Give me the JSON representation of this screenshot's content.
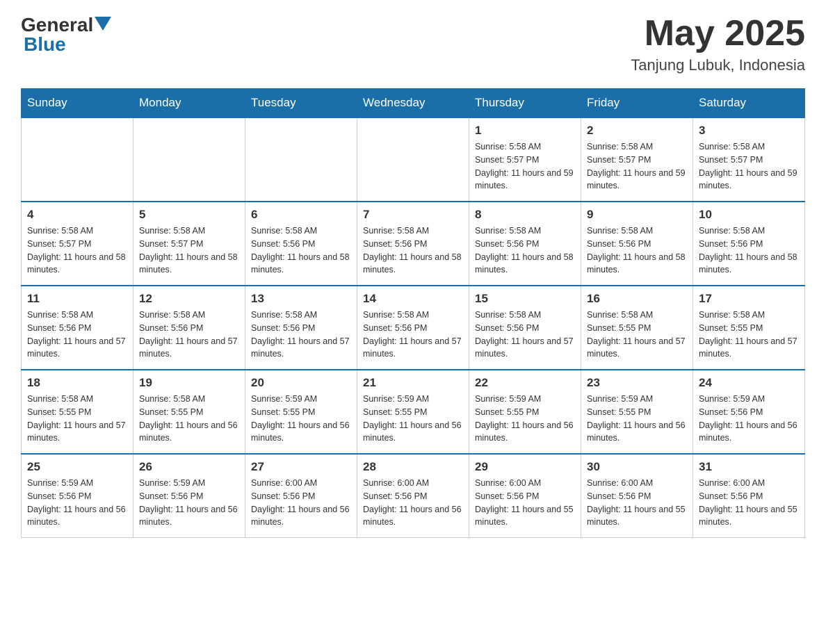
{
  "header": {
    "logo_general": "General",
    "logo_blue": "Blue",
    "month": "May 2025",
    "location": "Tanjung Lubuk, Indonesia"
  },
  "days_of_week": [
    "Sunday",
    "Monday",
    "Tuesday",
    "Wednesday",
    "Thursday",
    "Friday",
    "Saturday"
  ],
  "weeks": [
    [
      {
        "day": "",
        "sunrise": "",
        "sunset": "",
        "daylight": ""
      },
      {
        "day": "",
        "sunrise": "",
        "sunset": "",
        "daylight": ""
      },
      {
        "day": "",
        "sunrise": "",
        "sunset": "",
        "daylight": ""
      },
      {
        "day": "",
        "sunrise": "",
        "sunset": "",
        "daylight": ""
      },
      {
        "day": "1",
        "sunrise": "Sunrise: 5:58 AM",
        "sunset": "Sunset: 5:57 PM",
        "daylight": "Daylight: 11 hours and 59 minutes."
      },
      {
        "day": "2",
        "sunrise": "Sunrise: 5:58 AM",
        "sunset": "Sunset: 5:57 PM",
        "daylight": "Daylight: 11 hours and 59 minutes."
      },
      {
        "day": "3",
        "sunrise": "Sunrise: 5:58 AM",
        "sunset": "Sunset: 5:57 PM",
        "daylight": "Daylight: 11 hours and 59 minutes."
      }
    ],
    [
      {
        "day": "4",
        "sunrise": "Sunrise: 5:58 AM",
        "sunset": "Sunset: 5:57 PM",
        "daylight": "Daylight: 11 hours and 58 minutes."
      },
      {
        "day": "5",
        "sunrise": "Sunrise: 5:58 AM",
        "sunset": "Sunset: 5:57 PM",
        "daylight": "Daylight: 11 hours and 58 minutes."
      },
      {
        "day": "6",
        "sunrise": "Sunrise: 5:58 AM",
        "sunset": "Sunset: 5:56 PM",
        "daylight": "Daylight: 11 hours and 58 minutes."
      },
      {
        "day": "7",
        "sunrise": "Sunrise: 5:58 AM",
        "sunset": "Sunset: 5:56 PM",
        "daylight": "Daylight: 11 hours and 58 minutes."
      },
      {
        "day": "8",
        "sunrise": "Sunrise: 5:58 AM",
        "sunset": "Sunset: 5:56 PM",
        "daylight": "Daylight: 11 hours and 58 minutes."
      },
      {
        "day": "9",
        "sunrise": "Sunrise: 5:58 AM",
        "sunset": "Sunset: 5:56 PM",
        "daylight": "Daylight: 11 hours and 58 minutes."
      },
      {
        "day": "10",
        "sunrise": "Sunrise: 5:58 AM",
        "sunset": "Sunset: 5:56 PM",
        "daylight": "Daylight: 11 hours and 58 minutes."
      }
    ],
    [
      {
        "day": "11",
        "sunrise": "Sunrise: 5:58 AM",
        "sunset": "Sunset: 5:56 PM",
        "daylight": "Daylight: 11 hours and 57 minutes."
      },
      {
        "day": "12",
        "sunrise": "Sunrise: 5:58 AM",
        "sunset": "Sunset: 5:56 PM",
        "daylight": "Daylight: 11 hours and 57 minutes."
      },
      {
        "day": "13",
        "sunrise": "Sunrise: 5:58 AM",
        "sunset": "Sunset: 5:56 PM",
        "daylight": "Daylight: 11 hours and 57 minutes."
      },
      {
        "day": "14",
        "sunrise": "Sunrise: 5:58 AM",
        "sunset": "Sunset: 5:56 PM",
        "daylight": "Daylight: 11 hours and 57 minutes."
      },
      {
        "day": "15",
        "sunrise": "Sunrise: 5:58 AM",
        "sunset": "Sunset: 5:56 PM",
        "daylight": "Daylight: 11 hours and 57 minutes."
      },
      {
        "day": "16",
        "sunrise": "Sunrise: 5:58 AM",
        "sunset": "Sunset: 5:55 PM",
        "daylight": "Daylight: 11 hours and 57 minutes."
      },
      {
        "day": "17",
        "sunrise": "Sunrise: 5:58 AM",
        "sunset": "Sunset: 5:55 PM",
        "daylight": "Daylight: 11 hours and 57 minutes."
      }
    ],
    [
      {
        "day": "18",
        "sunrise": "Sunrise: 5:58 AM",
        "sunset": "Sunset: 5:55 PM",
        "daylight": "Daylight: 11 hours and 57 minutes."
      },
      {
        "day": "19",
        "sunrise": "Sunrise: 5:58 AM",
        "sunset": "Sunset: 5:55 PM",
        "daylight": "Daylight: 11 hours and 56 minutes."
      },
      {
        "day": "20",
        "sunrise": "Sunrise: 5:59 AM",
        "sunset": "Sunset: 5:55 PM",
        "daylight": "Daylight: 11 hours and 56 minutes."
      },
      {
        "day": "21",
        "sunrise": "Sunrise: 5:59 AM",
        "sunset": "Sunset: 5:55 PM",
        "daylight": "Daylight: 11 hours and 56 minutes."
      },
      {
        "day": "22",
        "sunrise": "Sunrise: 5:59 AM",
        "sunset": "Sunset: 5:55 PM",
        "daylight": "Daylight: 11 hours and 56 minutes."
      },
      {
        "day": "23",
        "sunrise": "Sunrise: 5:59 AM",
        "sunset": "Sunset: 5:55 PM",
        "daylight": "Daylight: 11 hours and 56 minutes."
      },
      {
        "day": "24",
        "sunrise": "Sunrise: 5:59 AM",
        "sunset": "Sunset: 5:56 PM",
        "daylight": "Daylight: 11 hours and 56 minutes."
      }
    ],
    [
      {
        "day": "25",
        "sunrise": "Sunrise: 5:59 AM",
        "sunset": "Sunset: 5:56 PM",
        "daylight": "Daylight: 11 hours and 56 minutes."
      },
      {
        "day": "26",
        "sunrise": "Sunrise: 5:59 AM",
        "sunset": "Sunset: 5:56 PM",
        "daylight": "Daylight: 11 hours and 56 minutes."
      },
      {
        "day": "27",
        "sunrise": "Sunrise: 6:00 AM",
        "sunset": "Sunset: 5:56 PM",
        "daylight": "Daylight: 11 hours and 56 minutes."
      },
      {
        "day": "28",
        "sunrise": "Sunrise: 6:00 AM",
        "sunset": "Sunset: 5:56 PM",
        "daylight": "Daylight: 11 hours and 56 minutes."
      },
      {
        "day": "29",
        "sunrise": "Sunrise: 6:00 AM",
        "sunset": "Sunset: 5:56 PM",
        "daylight": "Daylight: 11 hours and 55 minutes."
      },
      {
        "day": "30",
        "sunrise": "Sunrise: 6:00 AM",
        "sunset": "Sunset: 5:56 PM",
        "daylight": "Daylight: 11 hours and 55 minutes."
      },
      {
        "day": "31",
        "sunrise": "Sunrise: 6:00 AM",
        "sunset": "Sunset: 5:56 PM",
        "daylight": "Daylight: 11 hours and 55 minutes."
      }
    ]
  ]
}
